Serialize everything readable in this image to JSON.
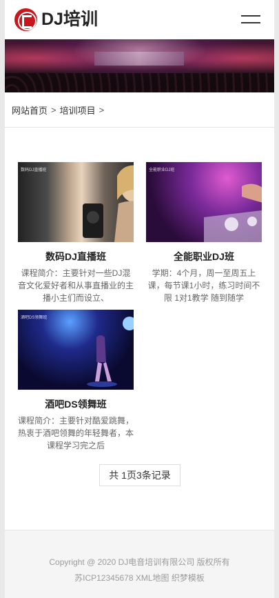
{
  "header": {
    "logo_text": "DJ培训"
  },
  "breadcrumb": {
    "home": "网站首页",
    "separator": ">",
    "current": "培训项目"
  },
  "courses": [
    {
      "image_caption": "数码DJ直播班",
      "title": "数码DJ直播班",
      "description": "课程简介：主要针对一些DJ混音文化爱好者和从事直播业的主播小主们而设立、"
    },
    {
      "image_caption": "全能职业DJ班",
      "title": "全能职业DJ班",
      "description": "学期：4个月，周一至周五上课，每节课1小时，练习时间不限 1对1教学 随到随学"
    },
    {
      "image_caption": "酒吧DS领舞班",
      "title": "酒吧DS领舞班",
      "description": "课程简介：主要针对酷爱跳舞，热衷于酒吧领舞的年轻舞者，本课程学习完之后"
    }
  ],
  "pagination": {
    "label": "共 1页3条记录"
  },
  "footer": {
    "line1": "Copyright @ 2020 DJ电音培训有限公司 版权所有",
    "line2": "苏ICP12345678 XML地图 织梦模板"
  },
  "colors": {
    "brand": "#c8161d",
    "text": "#333333",
    "muted": "#666666",
    "footer_text": "#9b9b9b"
  }
}
